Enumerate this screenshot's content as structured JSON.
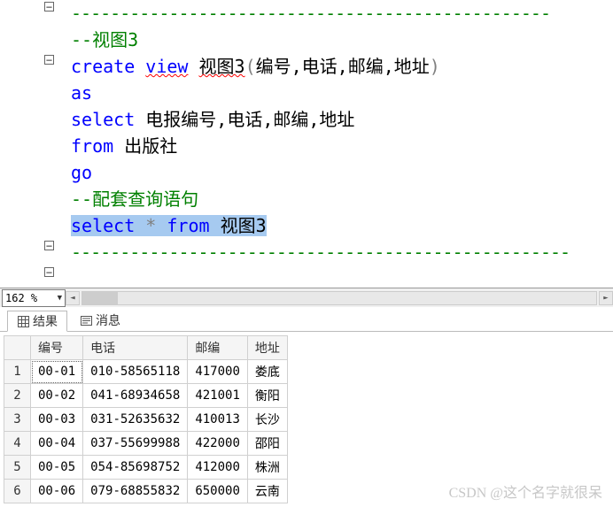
{
  "editor": {
    "dash": "-------------------------------------------------",
    "dash_end": "---------------------------------------------------",
    "comment1": "视图3",
    "kw_create": "create",
    "kw_view": "view",
    "view_name": "视图3",
    "cols_open": "(",
    "cols": "编号,电话,邮编,地址",
    "cols_close": ")",
    "kw_as": "as",
    "kw_select": "select",
    "select_cols": "电报编号,电话,邮编,地址",
    "kw_from": "from",
    "from_table": "出版社",
    "kw_go": "go",
    "comment2": "配套查询语句",
    "sel_line": {
      "kw_select": "select",
      "star": " * ",
      "kw_from": "from",
      "sp": " ",
      "target": "视图3"
    }
  },
  "zoom": {
    "value": "162 %"
  },
  "tabs": {
    "results": "结果",
    "messages": "消息"
  },
  "grid": {
    "headers": [
      "编号",
      "电话",
      "邮编",
      "地址"
    ],
    "rows": [
      [
        "00-01",
        "010-58565118",
        "417000",
        "娄底"
      ],
      [
        "00-02",
        "041-68934658",
        "421001",
        "衡阳"
      ],
      [
        "00-03",
        "031-52635632",
        "410013",
        "长沙"
      ],
      [
        "00-04",
        "037-55699988",
        "422000",
        "邵阳"
      ],
      [
        "00-05",
        "054-85698752",
        "412000",
        "株洲"
      ],
      [
        "00-06",
        "079-68855832",
        "650000",
        "云南"
      ]
    ]
  },
  "watermark": "CSDN @这个名字就很呆"
}
